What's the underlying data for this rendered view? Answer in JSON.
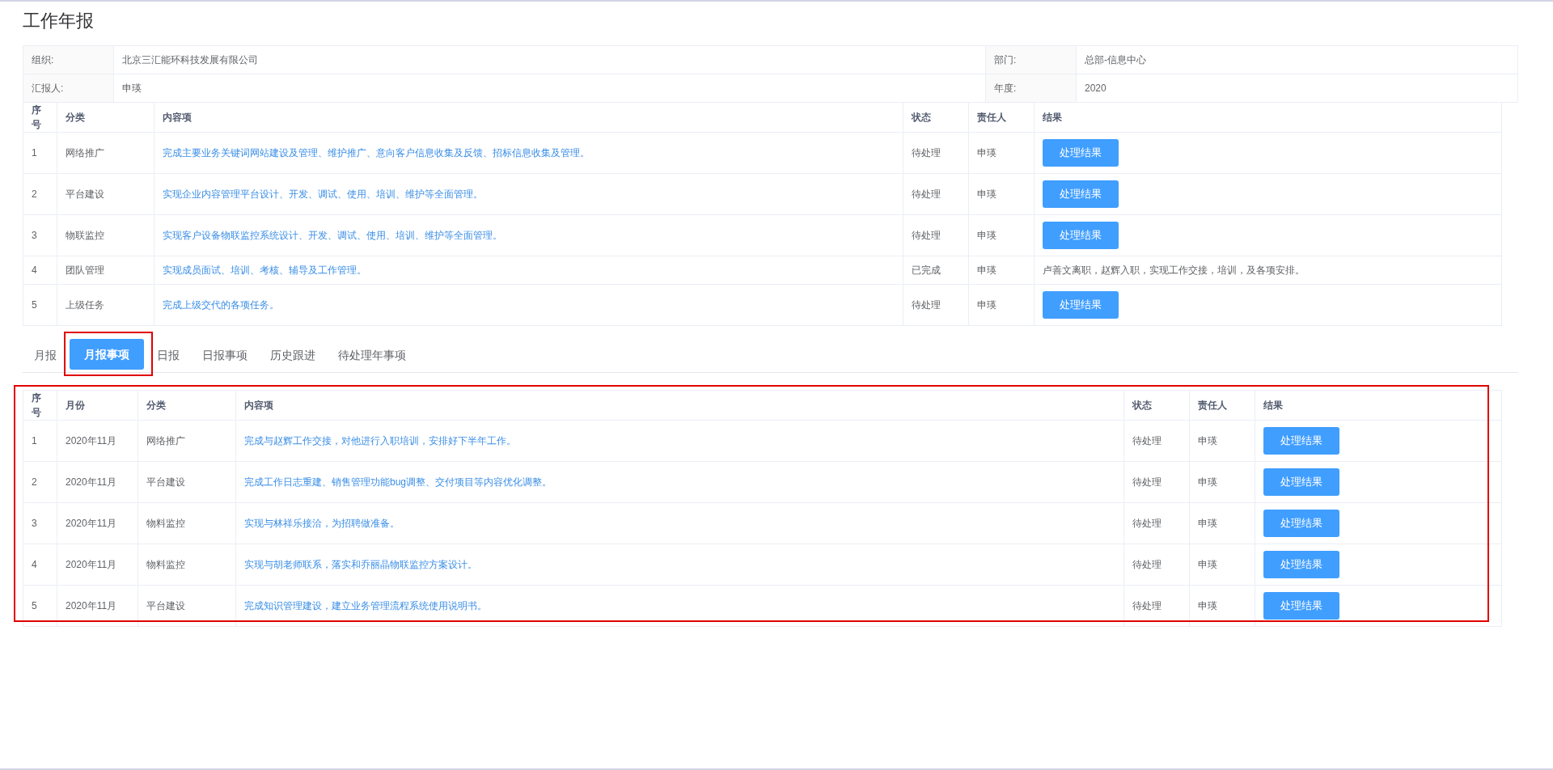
{
  "title": "工作年报",
  "info": [
    {
      "label": "组织:",
      "value": "北京三汇能环科技发展有限公司",
      "label2": "部门:",
      "value2": "总部-信息中心"
    },
    {
      "label": "汇报人:",
      "value": "申瑛",
      "label2": "年度:",
      "value2": "2020"
    }
  ],
  "year_table": {
    "columns": [
      "序号",
      "分类",
      "内容项",
      "状态",
      "责任人",
      "结果"
    ],
    "rows": [
      {
        "no": "1",
        "category": "网络推广",
        "content": "完成主要业务关键词网站建设及管理、维护推广、意向客户信息收集及反馈、招标信息收集及管理。",
        "status": "待处理",
        "owner": "申瑛",
        "result": {
          "kind": "button",
          "text": "处理结果"
        }
      },
      {
        "no": "2",
        "category": "平台建设",
        "content": "实现企业内容管理平台设计、开发、调试、使用、培训、维护等全面管理。",
        "status": "待处理",
        "owner": "申瑛",
        "result": {
          "kind": "button",
          "text": "处理结果"
        }
      },
      {
        "no": "3",
        "category": "物联监控",
        "content": "实现客户设备物联监控系统设计、开发、调试、使用、培训、维护等全面管理。",
        "status": "待处理",
        "owner": "申瑛",
        "result": {
          "kind": "button",
          "text": "处理结果"
        }
      },
      {
        "no": "4",
        "category": "团队管理",
        "content": "实现成员面试、培训、考核、辅导及工作管理。",
        "status": "已完成",
        "owner": "申瑛",
        "result": {
          "kind": "text",
          "text": "卢善文离职，赵辉入职，实现工作交接，培训，及各项安排。"
        }
      },
      {
        "no": "5",
        "category": "上级任务",
        "content": "完成上级交代的各项任务。",
        "status": "待处理",
        "owner": "申瑛",
        "result": {
          "kind": "button",
          "text": "处理结果"
        }
      }
    ]
  },
  "tabs": [
    {
      "label": "月报",
      "selected": false
    },
    {
      "label": "月报事项",
      "selected": true
    },
    {
      "label": "日报",
      "selected": false
    },
    {
      "label": "日报事项",
      "selected": false
    },
    {
      "label": "历史跟进",
      "selected": false
    },
    {
      "label": "待处理年事项",
      "selected": false
    }
  ],
  "month_table": {
    "columns": [
      "序号",
      "月份",
      "分类",
      "内容项",
      "状态",
      "责任人",
      "结果"
    ],
    "rows": [
      {
        "no": "1",
        "month": "2020年11月",
        "category": "网络推广",
        "content": "完成与赵辉工作交接，对他进行入职培训，安排好下半年工作。",
        "status": "待处理",
        "owner": "申瑛",
        "button": "处理结果"
      },
      {
        "no": "2",
        "month": "2020年11月",
        "category": "平台建设",
        "content": "完成工作日志重建、销售管理功能bug调整、交付项目等内容优化调整。",
        "status": "待处理",
        "owner": "申瑛",
        "button": "处理结果"
      },
      {
        "no": "3",
        "month": "2020年11月",
        "category": "物料监控",
        "content": "实现与林祥乐接洽，为招聘做准备。",
        "status": "待处理",
        "owner": "申瑛",
        "button": "处理结果"
      },
      {
        "no": "4",
        "month": "2020年11月",
        "category": "物料监控",
        "content": "实现与胡老师联系，落实和乔丽晶物联监控方案设计。",
        "status": "待处理",
        "owner": "申瑛",
        "button": "处理结果"
      },
      {
        "no": "5",
        "month": "2020年11月",
        "category": "平台建设",
        "content": "完成知识管理建设，建立业务管理流程系统使用说明书。",
        "status": "待处理",
        "owner": "申瑛",
        "button": "处理结果"
      }
    ]
  }
}
